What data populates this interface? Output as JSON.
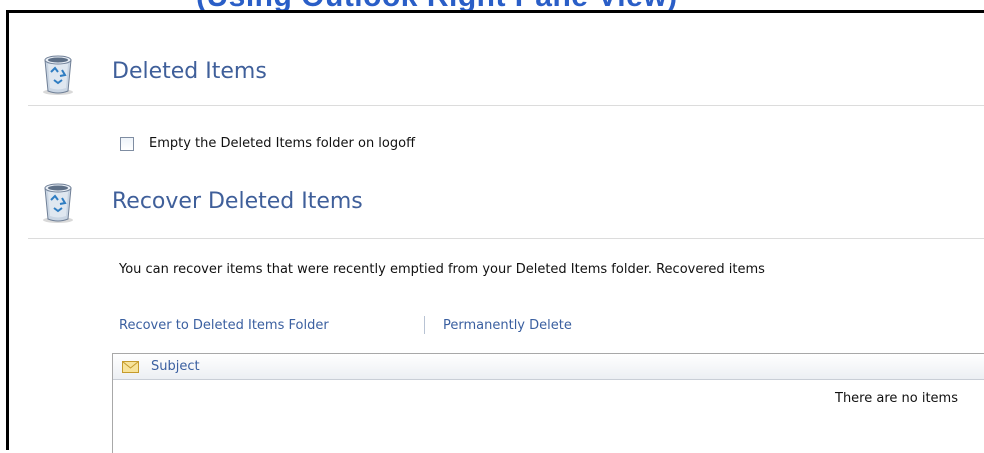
{
  "top_caption": "(Using Outlook Right Pane View)",
  "deleted_items": {
    "title": "Deleted Items",
    "checkbox_label": "Empty the Deleted Items folder on logoff",
    "checkbox_checked": false
  },
  "recover": {
    "title": "Recover Deleted Items",
    "description": "You can recover items that were recently emptied from your Deleted Items folder. Recovered items",
    "actions": {
      "recover_label": "Recover to Deleted Items Folder",
      "delete_label": "Permanently Delete"
    },
    "table": {
      "columns": [
        "Subject"
      ],
      "empty_message": "There are no items"
    }
  },
  "icons": [
    "recycle-bin-icon",
    "envelope-icon"
  ],
  "colors": {
    "title": "#3f5f9a",
    "link": "#3a5fa0",
    "caption": "#2a5ec7"
  }
}
